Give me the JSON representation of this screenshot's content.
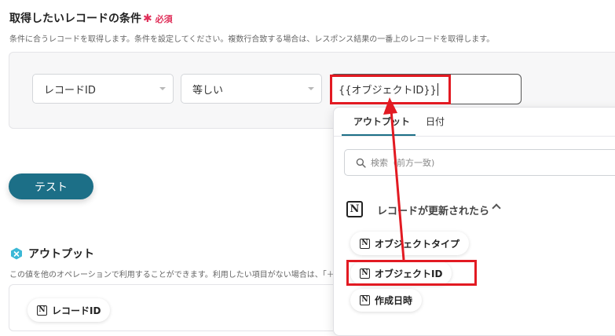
{
  "condition": {
    "title": "取得したいレコードの条件",
    "required_mark": "✱",
    "required_label": "必須",
    "description": "条件に合うレコードを取得します。条件を設定してください。複数行合致する場合は、レスポンス結果の一番上のレコードを取得します。",
    "field_select": "レコードID",
    "operator_select": "等しい",
    "value": "{{オブジェクトID}}"
  },
  "test_button": "テスト",
  "output": {
    "title": "アウトプット",
    "description": "この値を他のオペレーションで利用することができます。利用したい項目がない場合は、「＋",
    "items": [
      "レコードID"
    ]
  },
  "dropdown": {
    "tabs": [
      "アウトプット",
      "日付"
    ],
    "search_placeholder": "検索（前方一致)",
    "group_label": "レコードが更新されたら",
    "items": [
      "オブジェクトタイプ",
      "オブジェクトID",
      "作成日時"
    ]
  },
  "icons": {
    "notion": "notion-icon",
    "search": "search-icon",
    "output": "output-icon"
  },
  "colors": {
    "accent": "#1c6f87",
    "required": "#e0305a",
    "highlight": "#e21a22"
  }
}
